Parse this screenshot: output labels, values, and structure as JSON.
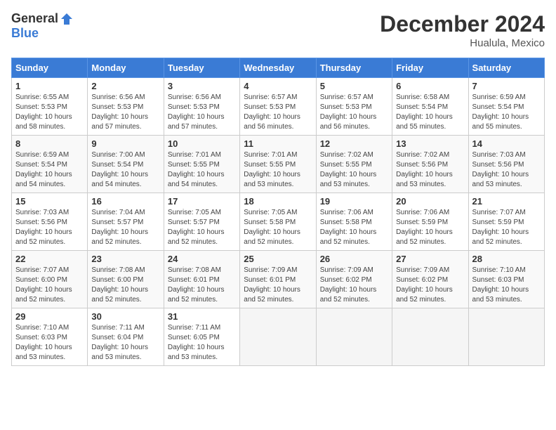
{
  "header": {
    "logo_general": "General",
    "logo_blue": "Blue",
    "month_title": "December 2024",
    "location": "Hualula, Mexico"
  },
  "weekdays": [
    "Sunday",
    "Monday",
    "Tuesday",
    "Wednesday",
    "Thursday",
    "Friday",
    "Saturday"
  ],
  "weeks": [
    [
      {
        "day": "1",
        "info": "Sunrise: 6:55 AM\nSunset: 5:53 PM\nDaylight: 10 hours\nand 58 minutes."
      },
      {
        "day": "2",
        "info": "Sunrise: 6:56 AM\nSunset: 5:53 PM\nDaylight: 10 hours\nand 57 minutes."
      },
      {
        "day": "3",
        "info": "Sunrise: 6:56 AM\nSunset: 5:53 PM\nDaylight: 10 hours\nand 57 minutes."
      },
      {
        "day": "4",
        "info": "Sunrise: 6:57 AM\nSunset: 5:53 PM\nDaylight: 10 hours\nand 56 minutes."
      },
      {
        "day": "5",
        "info": "Sunrise: 6:57 AM\nSunset: 5:53 PM\nDaylight: 10 hours\nand 56 minutes."
      },
      {
        "day": "6",
        "info": "Sunrise: 6:58 AM\nSunset: 5:54 PM\nDaylight: 10 hours\nand 55 minutes."
      },
      {
        "day": "7",
        "info": "Sunrise: 6:59 AM\nSunset: 5:54 PM\nDaylight: 10 hours\nand 55 minutes."
      }
    ],
    [
      {
        "day": "8",
        "info": "Sunrise: 6:59 AM\nSunset: 5:54 PM\nDaylight: 10 hours\nand 54 minutes."
      },
      {
        "day": "9",
        "info": "Sunrise: 7:00 AM\nSunset: 5:54 PM\nDaylight: 10 hours\nand 54 minutes."
      },
      {
        "day": "10",
        "info": "Sunrise: 7:01 AM\nSunset: 5:55 PM\nDaylight: 10 hours\nand 54 minutes."
      },
      {
        "day": "11",
        "info": "Sunrise: 7:01 AM\nSunset: 5:55 PM\nDaylight: 10 hours\nand 53 minutes."
      },
      {
        "day": "12",
        "info": "Sunrise: 7:02 AM\nSunset: 5:55 PM\nDaylight: 10 hours\nand 53 minutes."
      },
      {
        "day": "13",
        "info": "Sunrise: 7:02 AM\nSunset: 5:56 PM\nDaylight: 10 hours\nand 53 minutes."
      },
      {
        "day": "14",
        "info": "Sunrise: 7:03 AM\nSunset: 5:56 PM\nDaylight: 10 hours\nand 53 minutes."
      }
    ],
    [
      {
        "day": "15",
        "info": "Sunrise: 7:03 AM\nSunset: 5:56 PM\nDaylight: 10 hours\nand 52 minutes."
      },
      {
        "day": "16",
        "info": "Sunrise: 7:04 AM\nSunset: 5:57 PM\nDaylight: 10 hours\nand 52 minutes."
      },
      {
        "day": "17",
        "info": "Sunrise: 7:05 AM\nSunset: 5:57 PM\nDaylight: 10 hours\nand 52 minutes."
      },
      {
        "day": "18",
        "info": "Sunrise: 7:05 AM\nSunset: 5:58 PM\nDaylight: 10 hours\nand 52 minutes."
      },
      {
        "day": "19",
        "info": "Sunrise: 7:06 AM\nSunset: 5:58 PM\nDaylight: 10 hours\nand 52 minutes."
      },
      {
        "day": "20",
        "info": "Sunrise: 7:06 AM\nSunset: 5:59 PM\nDaylight: 10 hours\nand 52 minutes."
      },
      {
        "day": "21",
        "info": "Sunrise: 7:07 AM\nSunset: 5:59 PM\nDaylight: 10 hours\nand 52 minutes."
      }
    ],
    [
      {
        "day": "22",
        "info": "Sunrise: 7:07 AM\nSunset: 6:00 PM\nDaylight: 10 hours\nand 52 minutes."
      },
      {
        "day": "23",
        "info": "Sunrise: 7:08 AM\nSunset: 6:00 PM\nDaylight: 10 hours\nand 52 minutes."
      },
      {
        "day": "24",
        "info": "Sunrise: 7:08 AM\nSunset: 6:01 PM\nDaylight: 10 hours\nand 52 minutes."
      },
      {
        "day": "25",
        "info": "Sunrise: 7:09 AM\nSunset: 6:01 PM\nDaylight: 10 hours\nand 52 minutes."
      },
      {
        "day": "26",
        "info": "Sunrise: 7:09 AM\nSunset: 6:02 PM\nDaylight: 10 hours\nand 52 minutes."
      },
      {
        "day": "27",
        "info": "Sunrise: 7:09 AM\nSunset: 6:02 PM\nDaylight: 10 hours\nand 52 minutes."
      },
      {
        "day": "28",
        "info": "Sunrise: 7:10 AM\nSunset: 6:03 PM\nDaylight: 10 hours\nand 53 minutes."
      }
    ],
    [
      {
        "day": "29",
        "info": "Sunrise: 7:10 AM\nSunset: 6:03 PM\nDaylight: 10 hours\nand 53 minutes."
      },
      {
        "day": "30",
        "info": "Sunrise: 7:11 AM\nSunset: 6:04 PM\nDaylight: 10 hours\nand 53 minutes."
      },
      {
        "day": "31",
        "info": "Sunrise: 7:11 AM\nSunset: 6:05 PM\nDaylight: 10 hours\nand 53 minutes."
      },
      {
        "day": "",
        "info": ""
      },
      {
        "day": "",
        "info": ""
      },
      {
        "day": "",
        "info": ""
      },
      {
        "day": "",
        "info": ""
      }
    ]
  ]
}
